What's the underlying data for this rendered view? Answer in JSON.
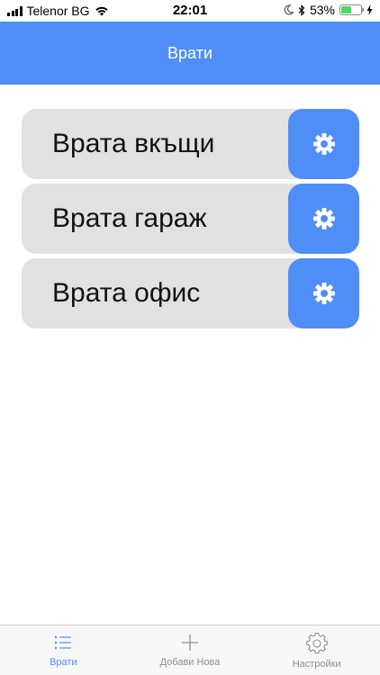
{
  "status_bar": {
    "carrier": "Telenor BG",
    "time": "22:01",
    "battery_percent": "53%",
    "battery_level": 0.53
  },
  "nav": {
    "title": "Врати"
  },
  "doors": [
    {
      "label": "Врата вкъщи"
    },
    {
      "label": "Врата гараж"
    },
    {
      "label": "Врата офис"
    }
  ],
  "tabs": [
    {
      "label": "Врати",
      "icon": "list-icon",
      "active": true
    },
    {
      "label": "Добави Нова",
      "icon": "plus-icon",
      "active": false
    },
    {
      "label": "Настройки",
      "icon": "gear-icon",
      "active": false
    }
  ],
  "colors": {
    "accent": "#4f8ef7",
    "item_background": "#e1e1e1",
    "battery": "#4cd964"
  }
}
